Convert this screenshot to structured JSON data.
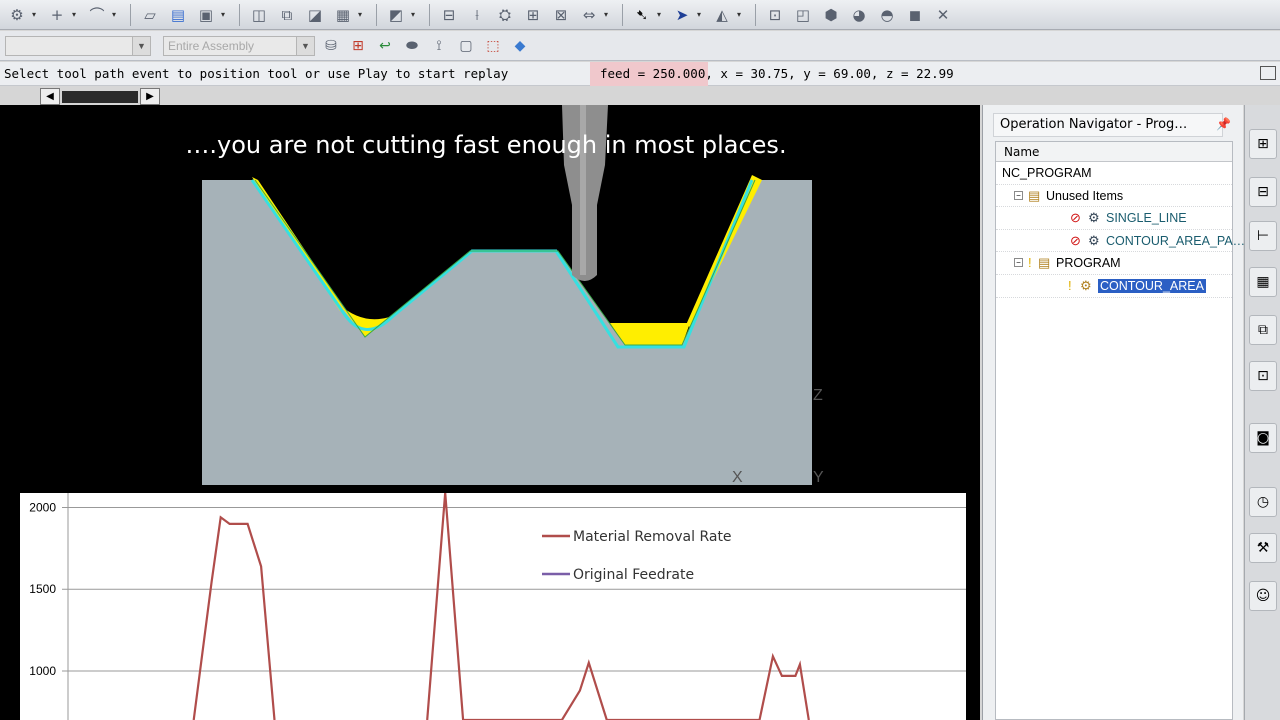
{
  "toolbar": {
    "row1_icons": [
      "gear-icon",
      "plus-icon",
      "curve-icon",
      "cube-icon",
      "stack-icon",
      "box-icon",
      "component-icon",
      "assembly-icon",
      "move-icon",
      "grid-icon",
      "section-icon",
      "operation-icon",
      "tool-icon",
      "mill-icon",
      "path-icon",
      "layer-icon",
      "select-icon",
      "arrow-icon",
      "cursor-icon",
      "fill-icon",
      "light-icon",
      "layout-icon",
      "shape-icon",
      "globe-icon",
      "blend-icon",
      "close-icon"
    ],
    "combo_filter": "",
    "combo_assembly": "Entire Assembly"
  },
  "status": {
    "prompt": "Select tool path event to position tool or use Play to start replay",
    "feed": "feed = 250.000, x = 30.75, y = 69.00, z = 22.99"
  },
  "viewport": {
    "caption": "….you are not cutting fast enough in most places.",
    "axis_z": "Z",
    "axis_x": "X",
    "axis_y": "Y"
  },
  "chart_data": {
    "type": "line",
    "series": [
      {
        "name": "Material Removal Rate",
        "color": "#b04d4b",
        "x": [
          0,
          0.14,
          0.16,
          0.17,
          0.18,
          0.2,
          0.215,
          0.23,
          0.24,
          0.4,
          0.42,
          0.44,
          0.55,
          0.57,
          0.58,
          0.6,
          0.77,
          0.785,
          0.795,
          0.81,
          0.815,
          0.825
        ],
        "y": [
          null,
          700,
          1550,
          1940,
          1900,
          1900,
          1640,
          700,
          null,
          700,
          2090,
          700,
          700,
          880,
          1050,
          700,
          700,
          1090,
          970,
          970,
          1040,
          700
        ]
      },
      {
        "name": "Original Feedrate",
        "color": "#7a5ea8",
        "x": [],
        "y": []
      }
    ],
    "yticks": [
      1000,
      1500,
      2000
    ],
    "ylim": [
      700,
      2150
    ],
    "grid": true,
    "legend": "top-right"
  },
  "navigator": {
    "title": "Operation Navigator - Prog…",
    "column": "Name",
    "items": [
      {
        "label": "NC_PROGRAM",
        "indent": 0,
        "expander": "",
        "status": ""
      },
      {
        "label": "Unused Items",
        "indent": 1,
        "expander": "−",
        "status": ""
      },
      {
        "label": "SINGLE_LINE",
        "indent": 2,
        "expander": "",
        "status": "no-entry"
      },
      {
        "label": "CONTOUR_AREA_PA…",
        "indent": 2,
        "expander": "",
        "status": "no-entry"
      },
      {
        "label": "PROGRAM",
        "indent": 1,
        "expander": "−",
        "status": "warning"
      },
      {
        "label": "CONTOUR_AREA",
        "indent": 2,
        "expander": "",
        "status": "warning"
      }
    ]
  },
  "resource_bar": [
    "assembly-nav-icon",
    "constraint-icon",
    "part-nav-icon",
    "reuse-library-icon",
    "hd3d-icon",
    "machine-tool-icon",
    "web-browser-icon",
    "history-icon",
    "roles-icon",
    "system-materials-icon"
  ]
}
